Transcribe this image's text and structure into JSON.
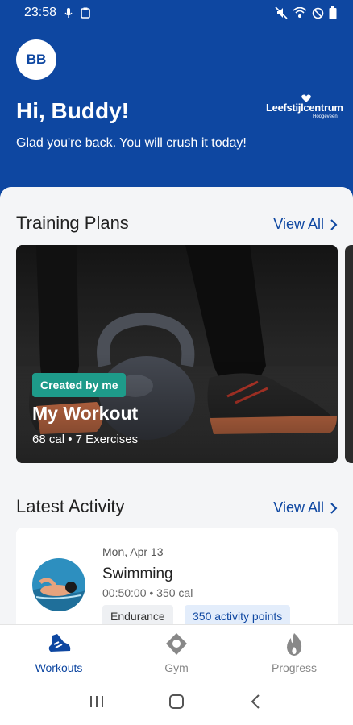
{
  "status_bar": {
    "time": "23:58"
  },
  "header": {
    "avatar_initials": "BB",
    "greeting": "Hi, Buddy!",
    "subgreeting": "Glad you're back. You will crush it today!",
    "logo_text": "Leefstijlcentrum",
    "logo_subtext": "Hoogeveen"
  },
  "training_plans": {
    "title": "Training Plans",
    "view_all": "View All",
    "card": {
      "badge": "Created by me",
      "name": "My Workout",
      "meta": "68 cal • 7 Exercises"
    }
  },
  "latest_activity": {
    "title": "Latest Activity",
    "view_all": "View All",
    "item": {
      "date": "Mon, Apr 13",
      "name": "Swimming",
      "meta": "00:50:00 • 350 cal",
      "tags": [
        "Endurance",
        "350 activity points"
      ]
    }
  },
  "bottom_nav": {
    "items": [
      {
        "label": "Workouts",
        "icon": "shoe-icon",
        "active": true
      },
      {
        "label": "Gym",
        "icon": "location-pin-icon",
        "active": false
      },
      {
        "label": "Progress",
        "icon": "flame-icon",
        "active": false
      }
    ]
  },
  "colors": {
    "brand_blue": "#0e47a1",
    "badge_teal": "#1e9b8a",
    "points_chip_bg": "#e3edfb"
  }
}
